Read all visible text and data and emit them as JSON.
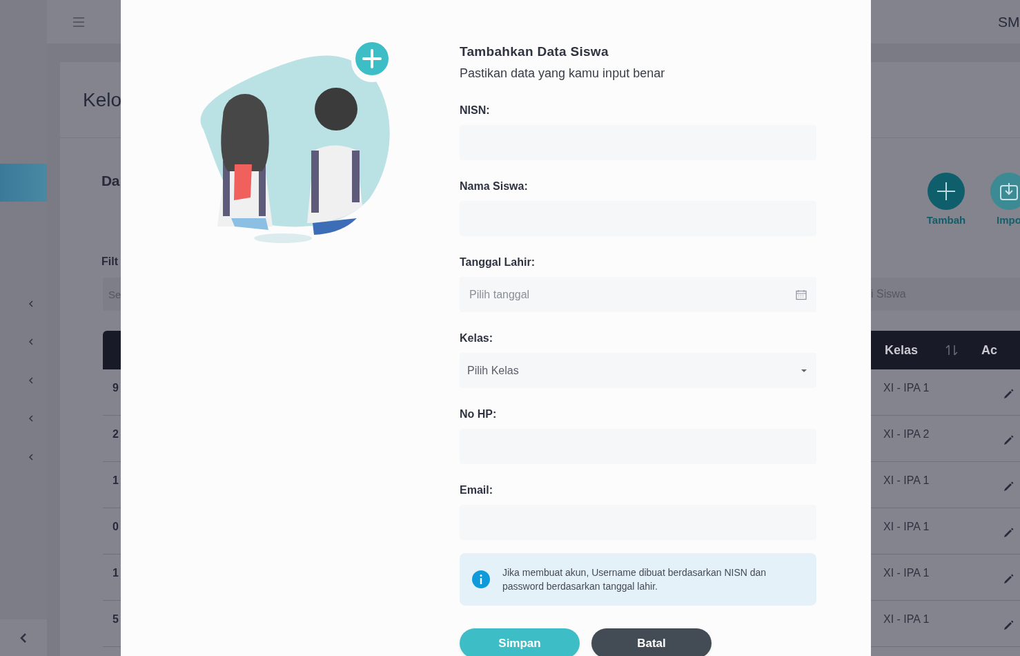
{
  "sidebar": {
    "items": [
      {
        "selected": true,
        "has_children": false
      },
      {
        "selected": false,
        "has_children": true
      },
      {
        "selected": false,
        "has_children": true
      },
      {
        "selected": false,
        "has_children": true
      },
      {
        "selected": false,
        "has_children": true
      },
      {
        "selected": false,
        "has_children": true
      }
    ]
  },
  "background_page": {
    "header": {
      "title": "SM"
    },
    "page_title": "Kelo",
    "section_title": "Da",
    "filter_label": "Filt",
    "search_left": {
      "placeholder": "Se"
    },
    "search_right": {
      "placeholder": "i Siswa"
    },
    "actions": [
      {
        "kind": "add",
        "label": "Tambah"
      },
      {
        "kind": "import",
        "label": "Impo"
      }
    ],
    "table": {
      "columns": [
        {
          "label": "Kelas",
          "sortable": true
        },
        {
          "label": "Ac",
          "sortable": false
        }
      ],
      "rows": [
        {
          "column_1": "9",
          "kelas": "XI - IPA 1"
        },
        {
          "column_1": "2",
          "kelas": "XI - IPA 2"
        },
        {
          "column_1": "1",
          "kelas": "XI - IPA 1"
        },
        {
          "column_1": "0",
          "kelas": "XI - IPA 1"
        },
        {
          "column_1": "1",
          "kelas": "XI - IPA 1"
        },
        {
          "column_1": "5",
          "kelas": "XI - IPA 1"
        }
      ]
    }
  },
  "modal": {
    "title": "Tambahkan Data Siswa",
    "subtitle": "Pastikan data yang kamu input benar",
    "fields": [
      {
        "kind": "text",
        "label": "NISN:"
      },
      {
        "kind": "text",
        "label": "Nama Siswa:"
      },
      {
        "kind": "date",
        "label": "Tanggal Lahir:",
        "placeholder": "Pilih tanggal"
      },
      {
        "kind": "select",
        "label": "Kelas:",
        "placeholder": "Pilih Kelas"
      },
      {
        "kind": "text",
        "label": "No HP:"
      },
      {
        "kind": "text",
        "label": "Email:"
      }
    ],
    "info": "Jika membuat akun, Username dibuat berdasarkan NISN dan password berdasarkan tanggal lahir.",
    "buttons": [
      {
        "kind": "primary",
        "label": "Simpan"
      },
      {
        "kind": "secondary",
        "label": "Batal"
      }
    ]
  }
}
